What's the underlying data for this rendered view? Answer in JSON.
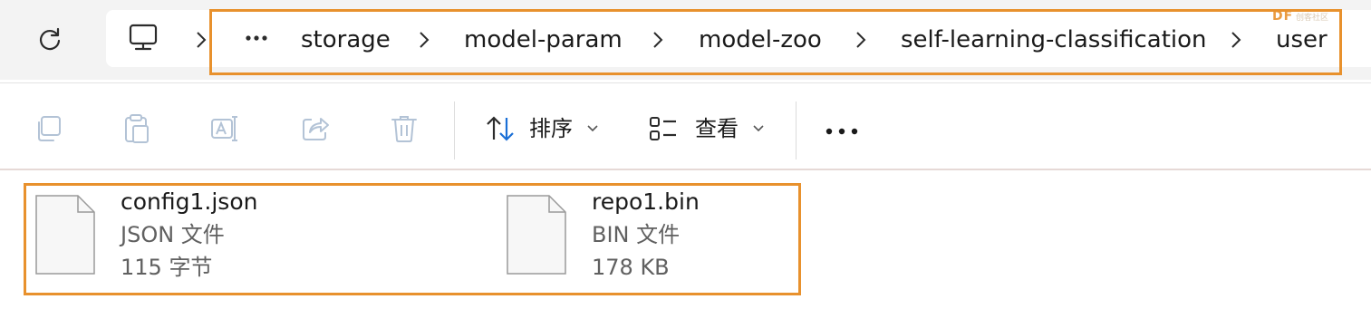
{
  "address_bar": {
    "breadcrumbs": [
      "storage",
      "model-param",
      "model-zoo",
      "self-learning-classification",
      "user"
    ],
    "highlight_color": "#e8912d"
  },
  "watermark": {
    "logo": "DF",
    "subtext": "创客社区"
  },
  "toolbar": {
    "sort_label": "排序",
    "view_label": "查看"
  },
  "files": [
    {
      "name": "config1.json",
      "type": "JSON 文件",
      "size": "115 字节"
    },
    {
      "name": "repo1.bin",
      "type": "BIN 文件",
      "size": "178 KB"
    }
  ]
}
